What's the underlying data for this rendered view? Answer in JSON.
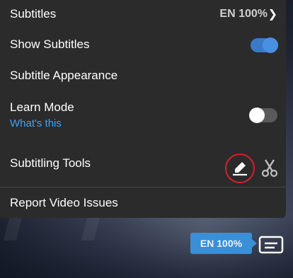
{
  "menu": {
    "subtitles": {
      "label": "Subtitles",
      "value": "EN 100%"
    },
    "show_subtitles": {
      "label": "Show Subtitles",
      "enabled": true
    },
    "subtitle_appearance": {
      "label": "Subtitle Appearance"
    },
    "learn_mode": {
      "label": "Learn Mode",
      "link": "What's this",
      "enabled": false
    },
    "subtitling_tools": {
      "label": "Subtitling Tools"
    },
    "report": {
      "label": "Report Video Issues"
    }
  },
  "player": {
    "language_badge": "EN 100%"
  },
  "colors": {
    "menu_bg": "#2b2b2b",
    "accent_blue": "#3a8fd6",
    "link_blue": "#3fa2f2",
    "highlight_red": "#d6202a"
  },
  "icons": {
    "chevron": "chevron-right-icon",
    "pencil": "pencil-edit-icon",
    "scissors": "scissors-icon",
    "subtitles": "subtitles-icon"
  }
}
